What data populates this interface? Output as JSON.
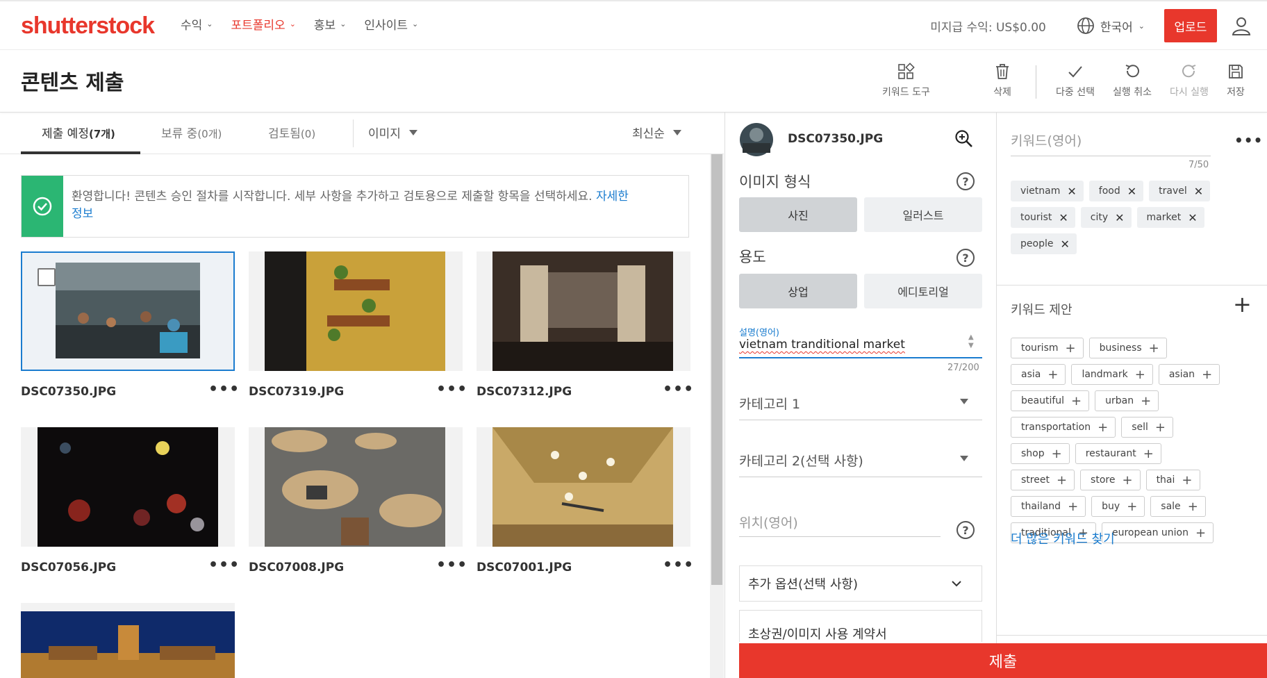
{
  "header": {
    "logo": "shutterstock",
    "nav": [
      {
        "label": "수익",
        "active": false
      },
      {
        "label": "포트폴리오",
        "active": true
      },
      {
        "label": "홍보",
        "active": false
      },
      {
        "label": "인사이트",
        "active": false
      }
    ],
    "earnings": "미지급 수익: US$0.00",
    "language": "한국어",
    "upload": "업로드"
  },
  "titlebar": {
    "title": "콘텐츠 제출",
    "tools": {
      "keyword_tool": "키워드 도구",
      "delete": "삭제",
      "multi_select": "다중 선택",
      "undo": "실행 취소",
      "redo": "다시 실행",
      "save": "저장"
    }
  },
  "tabs": {
    "to_submit_label": "제출 예정",
    "to_submit_count": "(7개)",
    "pending_label": "보류 중",
    "pending_count": "(0개)",
    "reviewed_label": "검토됨",
    "reviewed_count": "(0)",
    "media_filter": "이미지",
    "sort": "최신순"
  },
  "banner": {
    "message": "환영합니다! 콘텐츠 승인 절차를 시작합니다. 세부 사항을 추가하고 검토용으로 제출할 항목을 선택하세요.",
    "link_part1": "자세한",
    "link_part2": "정보"
  },
  "grid": [
    {
      "filename": "DSC07350.JPG"
    },
    {
      "filename": "DSC07319.JPG"
    },
    {
      "filename": "DSC07312.JPG"
    },
    {
      "filename": "DSC07056.JPG"
    },
    {
      "filename": "DSC07008.JPG"
    },
    {
      "filename": "DSC07001.JPG"
    }
  ],
  "editor": {
    "filename": "DSC07350.JPG",
    "image_type_label": "이미지 형식",
    "image_type_options": [
      "사진",
      "일러스트"
    ],
    "usage_label": "용도",
    "usage_options": [
      "상업",
      "에디토리얼"
    ],
    "description_label": "설명(영어)",
    "description_value": "vietnam tranditional market",
    "description_count": "27/200",
    "category1": "카테고리 1",
    "category2": "카테고리 2(선택 사항)",
    "location_placeholder": "위치(영어)",
    "extra_options": "추가 옵션(선택 사항)",
    "release_partial": "초상권/이미지 사용 계약서",
    "submit": "제출"
  },
  "keywords": {
    "label": "키워드(영어)",
    "count": "7/50",
    "items": [
      "vietnam",
      "food",
      "travel",
      "tourist",
      "city",
      "market",
      "people"
    ]
  },
  "suggestions": {
    "label": "키워드 제안",
    "items": [
      "tourism",
      "business",
      "asia",
      "landmark",
      "asian",
      "beautiful",
      "urban",
      "transportation",
      "sell",
      "shop",
      "restaurant",
      "street",
      "store",
      "thai",
      "thailand",
      "buy",
      "sale",
      "traditional",
      "european union"
    ],
    "more_link": "더 많은 키워드 찾기"
  },
  "colors": {
    "brand": "#e8372c",
    "success": "#2bb673",
    "link": "#1a7ccf"
  }
}
